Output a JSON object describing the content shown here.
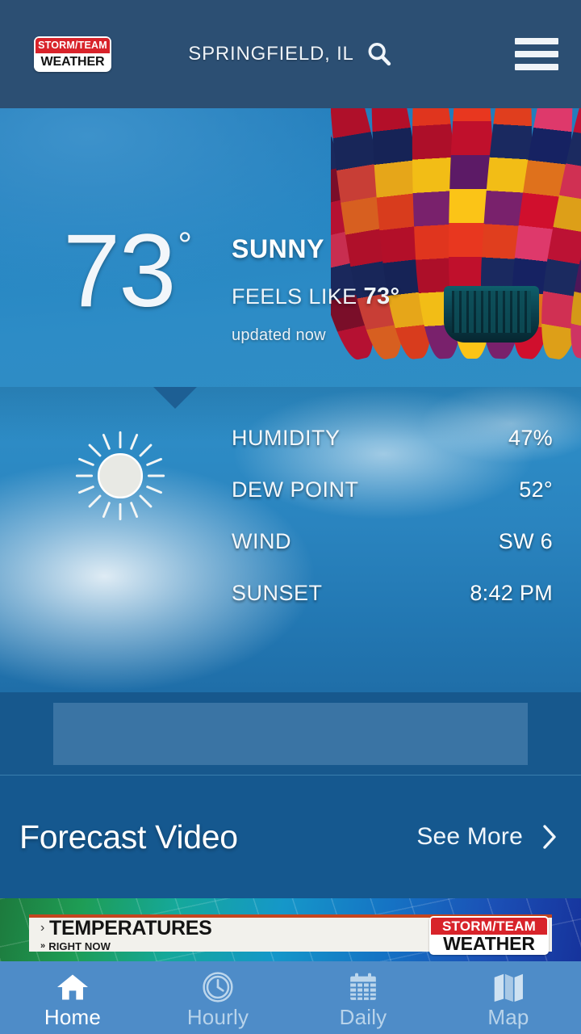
{
  "header": {
    "logo": {
      "line1": "STORM/TEAM",
      "line2": "WEATHER",
      "name": "storm-team-weather-logo"
    },
    "location": "SPRINGFIELD, IL",
    "search_icon": "search-icon",
    "menu_icon": "hamburger-menu-icon"
  },
  "current": {
    "temperature": "73",
    "degree": "°",
    "condition": "SUNNY",
    "feels_like_label": "FEELS LIKE",
    "feels_like_value": "73°",
    "updated": "updated now",
    "hero_icon": "hot-air-balloon-photo"
  },
  "details": {
    "icon": "sun-icon",
    "rows": [
      {
        "label": "HUMIDITY",
        "value": "47%"
      },
      {
        "label": "DEW POINT",
        "value": "52°"
      },
      {
        "label": "WIND",
        "value": "SW 6"
      },
      {
        "label": "SUNSET",
        "value": "8:42 PM"
      }
    ]
  },
  "ad_slot": {
    "label": ""
  },
  "forecast_video": {
    "title": "Forecast Video",
    "see_more": "See More",
    "chevron_icon": "chevron-right-icon"
  },
  "banner": {
    "headline": "TEMPERATURES",
    "subline": "RIGHT NOW",
    "headline_caret": "›",
    "subline_caret": "»",
    "logo": {
      "line1": "STORM/TEAM",
      "line2": "WEATHER"
    }
  },
  "nav": {
    "items": [
      {
        "label": "Home",
        "icon": "home-icon",
        "active": true
      },
      {
        "label": "Hourly",
        "icon": "clock-icon",
        "active": false
      },
      {
        "label": "Daily",
        "icon": "calendar-icon",
        "active": false
      },
      {
        "label": "Map",
        "icon": "map-icon",
        "active": false
      }
    ]
  },
  "colors": {
    "header_bg": "#2c4f73",
    "nav_bg": "#4e8cc8",
    "forecast_bg": "#15588f",
    "ad_bg": "#17588d",
    "logo_red": "#d8232a",
    "accent_white": "#ffffff"
  }
}
